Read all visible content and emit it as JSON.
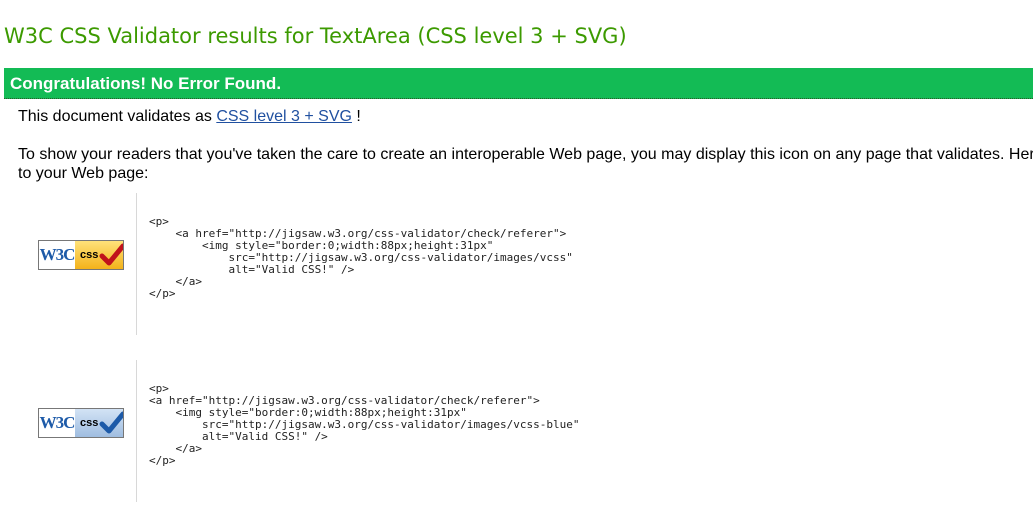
{
  "header": {
    "title": "W3C CSS Validator results for TextArea (CSS level 3 + SVG)"
  },
  "banner": {
    "text": "Congratulations! No Error Found."
  },
  "validation": {
    "prefix": "This document validates as ",
    "link_text": "CSS level 3 + SVG",
    "suffix": " !"
  },
  "info": {
    "line1": "To show your readers that you've taken the care to create an interoperable Web page, you may display this icon on any page that validates. Her",
    "line2": "to your Web page:"
  },
  "badges": [
    {
      "w3c": "W3C",
      "css": "css",
      "style": "gold",
      "accent_color": "#f3b21a",
      "check_color": "#c0121b",
      "code": "<p>\n    <a href=\"http://jigsaw.w3.org/css-validator/check/referer\">\n        <img style=\"border:0;width:88px;height:31px\"\n            src=\"http://jigsaw.w3.org/css-validator/images/vcss\"\n            alt=\"Valid CSS!\" />\n    </a>\n</p>"
    },
    {
      "w3c": "W3C",
      "css": "css",
      "style": "blue",
      "accent_color": "#9fbde0",
      "check_color": "#1d5aa8",
      "code": "<p>\n<a href=\"http://jigsaw.w3.org/css-validator/check/referer\">\n    <img style=\"border:0;width:88px;height:31px\"\n        src=\"http://jigsaw.w3.org/css-validator/images/vcss-blue\"\n        alt=\"Valid CSS!\" />\n    </a>\n</p>"
    }
  ],
  "colors": {
    "title": "#3c9a00",
    "banner_bg": "#13bb55",
    "link": "#2050a0"
  }
}
